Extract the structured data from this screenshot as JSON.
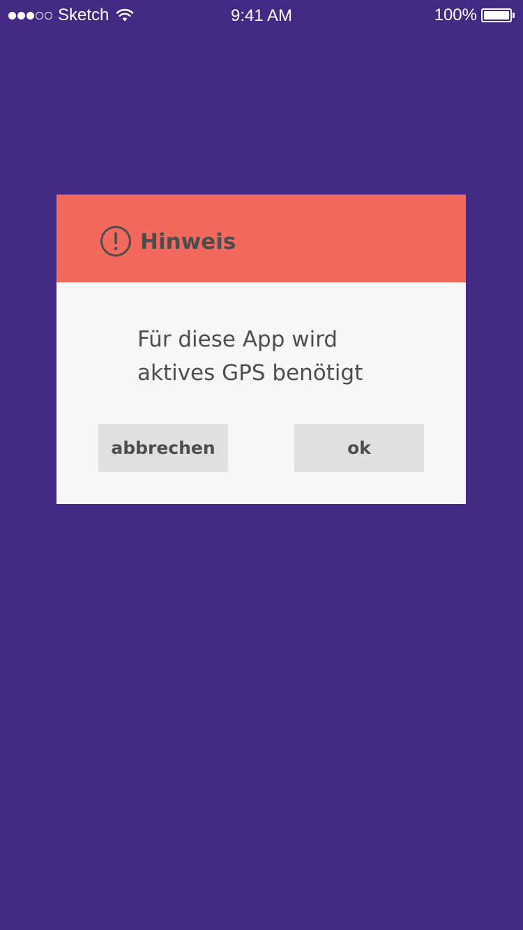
{
  "status_bar": {
    "carrier": "Sketch",
    "signal_bars_filled": 3,
    "signal_bars_total": 5,
    "time": "9:41 AM",
    "battery_percent_label": "100%",
    "battery_level": 1.0,
    "icons": [
      "signal-dots-icon",
      "wifi-icon",
      "battery-icon"
    ]
  },
  "dialog": {
    "header_icon": "exclamation-circle-icon",
    "title": "Hinweis",
    "message_line1": "Für diese App wird",
    "message_line2": "aktives GPS benötigt",
    "cancel_label": "abbrechen",
    "ok_label": "ok"
  },
  "colors": {
    "background": "#432983",
    "header": "#f4695d",
    "dialog_body": "#f7f7f7",
    "button": "#e0e0e0",
    "text": "#4d4d4d",
    "status_text": "#ffffff"
  }
}
